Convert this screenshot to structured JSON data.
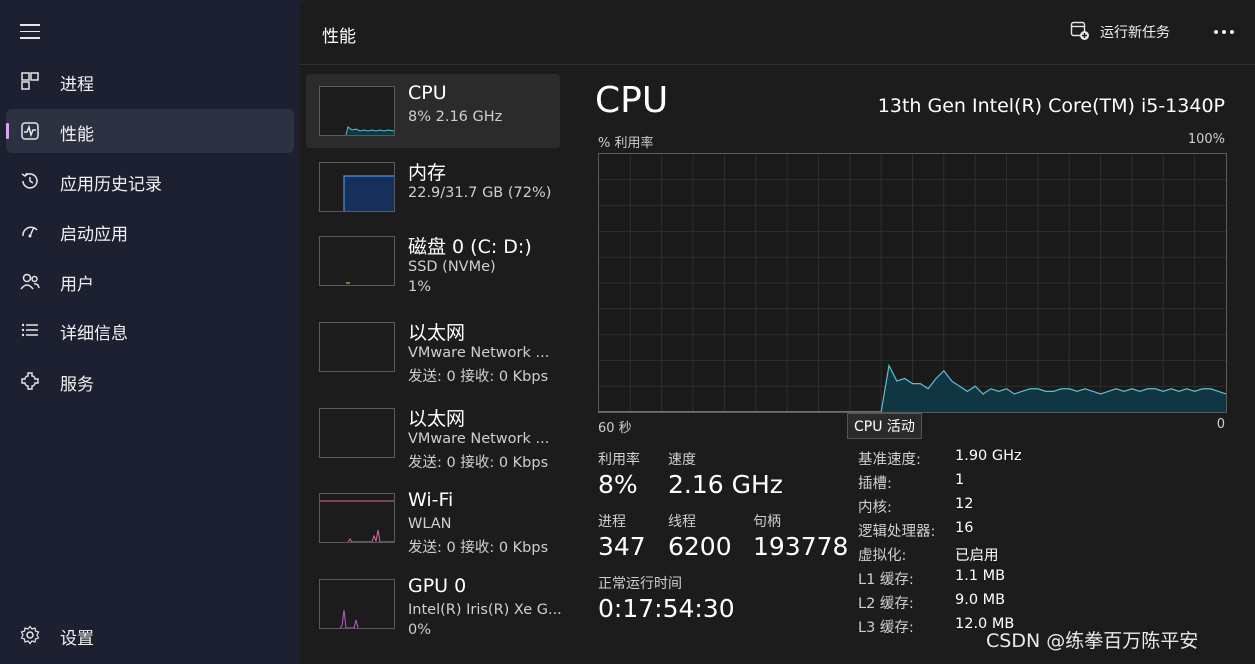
{
  "nav": {
    "items": [
      {
        "label": "进程",
        "icon": "processes-icon"
      },
      {
        "label": "性能",
        "icon": "performance-icon",
        "active": true
      },
      {
        "label": "应用历史记录",
        "icon": "history-icon"
      },
      {
        "label": "启动应用",
        "icon": "startup-icon"
      },
      {
        "label": "用户",
        "icon": "users-icon"
      },
      {
        "label": "详细信息",
        "icon": "details-icon"
      },
      {
        "label": "服务",
        "icon": "services-icon"
      }
    ],
    "settings_label": "设置"
  },
  "header": {
    "title": "性能",
    "run_task_label": "运行新任务"
  },
  "devices": [
    {
      "name": "CPU",
      "line1": "8%  2.16 GHz",
      "line2": ""
    },
    {
      "name": "内存",
      "line1": "22.9/31.7 GB (72%)",
      "line2": ""
    },
    {
      "name": "磁盘 0 (C: D:)",
      "line1": "SSD (NVMe)",
      "line2": "1%"
    },
    {
      "name": "以太网",
      "line1": "VMware Network ...",
      "line2": "发送: 0 接收: 0 Kbps"
    },
    {
      "name": "以太网",
      "line1": "VMware Network ...",
      "line2": "发送: 0 接收: 0 Kbps"
    },
    {
      "name": "Wi-Fi",
      "line1": "WLAN",
      "line2": "发送: 0 接收: 0 Kbps"
    },
    {
      "name": "GPU 0",
      "line1": "Intel(R) Iris(R) Xe G...",
      "line2": "0%"
    }
  ],
  "detail": {
    "title": "CPU",
    "model": "13th Gen Intel(R) Core(TM) i5-1340P",
    "graph_label_left": "% 利用率",
    "graph_label_right": "100%",
    "x_left": "60 秒",
    "x_right": "0",
    "tooltip": "CPU 活动",
    "stats": {
      "utilization_label": "利用率",
      "utilization": "8%",
      "speed_label": "速度",
      "speed": "2.16 GHz",
      "processes_label": "进程",
      "processes": "347",
      "threads_label": "线程",
      "threads": "6200",
      "handles_label": "句柄",
      "handles": "193778",
      "uptime_label": "正常运行时间",
      "uptime": "0:17:54:30"
    },
    "specs": [
      {
        "k": "基准速度:",
        "v": "1.90 GHz"
      },
      {
        "k": "插槽:",
        "v": "1"
      },
      {
        "k": "内核:",
        "v": "12"
      },
      {
        "k": "逻辑处理器:",
        "v": "16"
      },
      {
        "k": "虚拟化:",
        "v": "已启用"
      },
      {
        "k": "L1 缓存:",
        "v": "1.1 MB"
      },
      {
        "k": "L2 缓存:",
        "v": "9.0 MB"
      },
      {
        "k": "L3 缓存:",
        "v": "12.0 MB"
      }
    ],
    "utilization_history": [
      0,
      0,
      0,
      0,
      0,
      0,
      0,
      0,
      0,
      0,
      0,
      0,
      0,
      0,
      0,
      0,
      0,
      0,
      0,
      0,
      0,
      0,
      0,
      0,
      0,
      0,
      0,
      0,
      0,
      0,
      0,
      0,
      0,
      0,
      0,
      0,
      0,
      18,
      12,
      13,
      11,
      11,
      9,
      13,
      16,
      12,
      10,
      8,
      10,
      7,
      9,
      8,
      9,
      7,
      8,
      9,
      9,
      8,
      8,
      9,
      9,
      8,
      9,
      8,
      7,
      8,
      9,
      8,
      9,
      8,
      9,
      9,
      8,
      9,
      8,
      9,
      8,
      9,
      9,
      8,
      7
    ],
    "colors": {
      "line": "#5bc0d6",
      "fill": "#0f3641",
      "grid": "#2f2f2f"
    }
  },
  "watermark": "CSDN @练拳百万陈平安"
}
